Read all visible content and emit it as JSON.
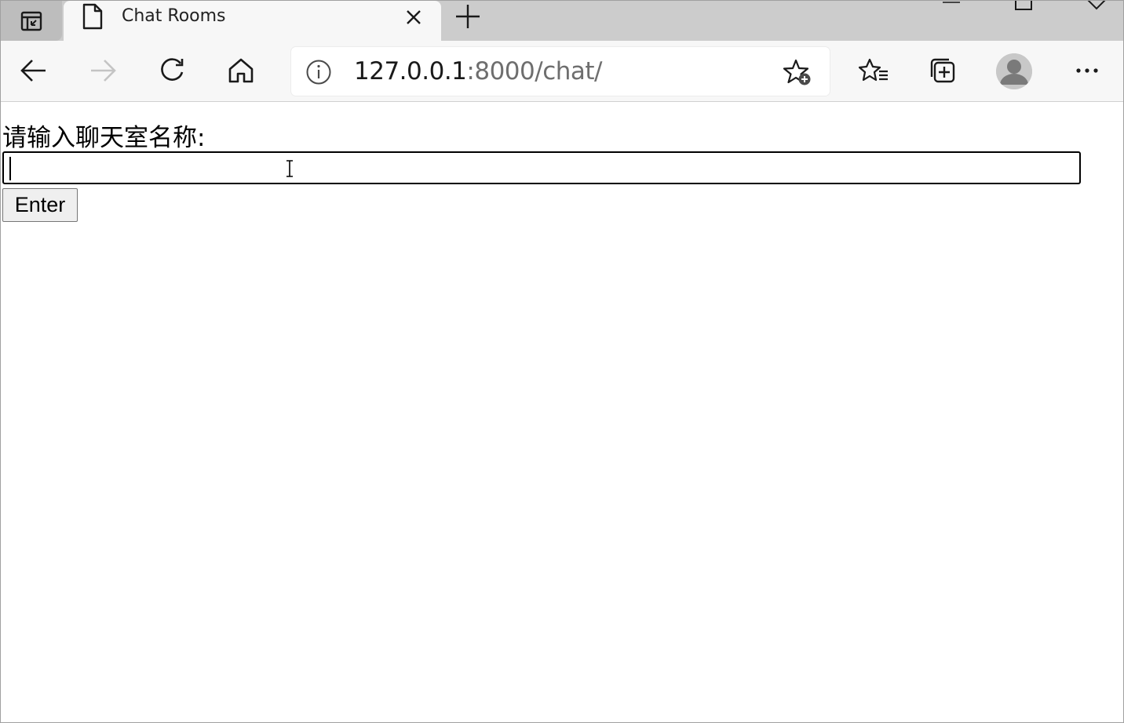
{
  "browser": {
    "tab": {
      "title": "Chat Rooms"
    },
    "address_bar": {
      "url_host": "127.0.0.1",
      "url_rest": ":8000/chat/"
    },
    "icons": {
      "tab_actions": "tab-actions-icon",
      "favicon": "page-icon",
      "close": "close-icon",
      "new_tab": "plus-icon",
      "back": "back-arrow-icon",
      "forward": "forward-arrow-icon",
      "refresh": "refresh-icon",
      "home": "home-icon",
      "site_info": "info-icon",
      "add_favorite": "star-add-icon",
      "favorites": "favorites-icon",
      "collections": "collections-icon",
      "profile": "avatar",
      "menu": "more-icon"
    },
    "forward_enabled": false
  },
  "page": {
    "label": "请输入聊天室名称:",
    "input_value": "",
    "enter_button": "Enter"
  }
}
